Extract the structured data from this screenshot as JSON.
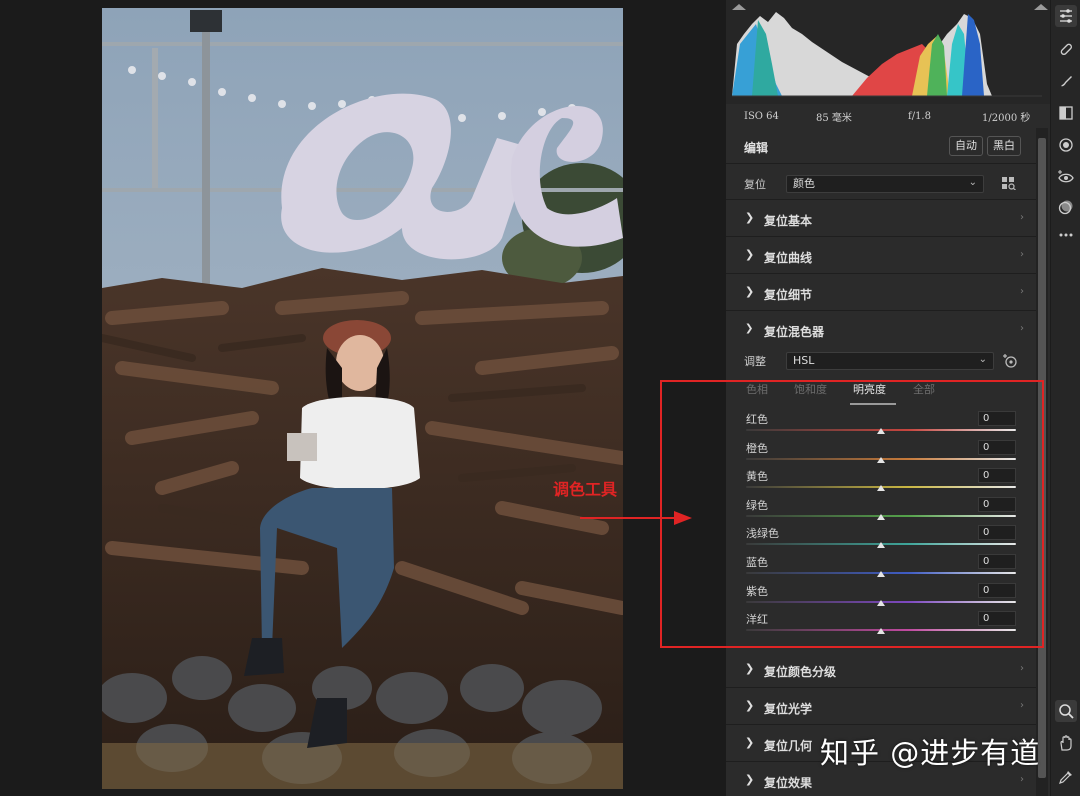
{
  "exif": {
    "iso": "ISO 64",
    "focal": "85 毫米",
    "aperture": "f/1.8",
    "shutter": "1/2000 秒"
  },
  "edit": {
    "title": "编辑",
    "auto_label": "自动",
    "bw_label": "黑白"
  },
  "preset": {
    "label": "复位",
    "value": "颜色"
  },
  "sections_top": [
    {
      "label": "复位基本"
    },
    {
      "label": "复位曲线"
    },
    {
      "label": "复位细节"
    }
  ],
  "mixer": {
    "label": "复位混色器",
    "adjust_label": "调整",
    "adjust_value": "HSL",
    "tabs": [
      "色相",
      "饱和度",
      "明亮度",
      "全部"
    ],
    "active_tab": "明亮度",
    "sliders": [
      {
        "label": "红色",
        "value": "0",
        "color": "#c7453e"
      },
      {
        "label": "橙色",
        "value": "0",
        "color": "#c77a3a"
      },
      {
        "label": "黄色",
        "value": "0",
        "color": "#c9b642"
      },
      {
        "label": "绿色",
        "value": "0",
        "color": "#54a24a"
      },
      {
        "label": "浅绿色",
        "value": "0",
        "color": "#3ea59a"
      },
      {
        "label": "蓝色",
        "value": "0",
        "color": "#3f5cc4"
      },
      {
        "label": "紫色",
        "value": "0",
        "color": "#7d48c0"
      },
      {
        "label": "洋红",
        "value": "0",
        "color": "#c04aa0"
      }
    ]
  },
  "sections_bottom": [
    {
      "label": "复位颜色分级"
    },
    {
      "label": "复位光学"
    },
    {
      "label": "复位几何"
    },
    {
      "label": "复位效果"
    }
  ],
  "annotation": {
    "label": "调色工具",
    "color": "#e02424"
  },
  "watermark": "知乎 @进步有道"
}
